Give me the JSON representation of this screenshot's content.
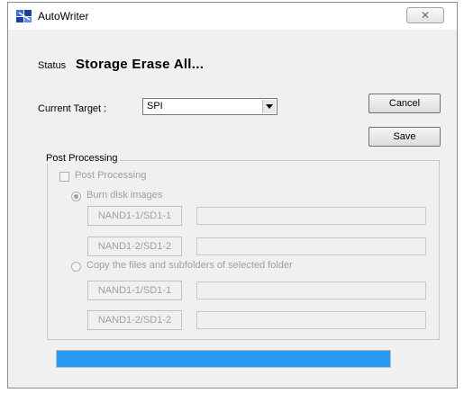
{
  "window": {
    "title": "AutoWriter",
    "close_glyph": "✕",
    "accent_color": "#2b9af3"
  },
  "status": {
    "label": "Status",
    "value": "Storage Erase All..."
  },
  "target": {
    "label": "Current Target :",
    "selected": "SPI"
  },
  "buttons": {
    "cancel": "Cancel",
    "save": "Save"
  },
  "post_processing": {
    "legend": "Post Processing",
    "checkbox_label": "Post Processing",
    "checkbox_checked": false,
    "burn": {
      "label": "Burn disk images",
      "selected": true,
      "rows": [
        {
          "button": "NAND1-1/SD1-1",
          "value": ""
        },
        {
          "button": "NAND1-2/SD1-2",
          "value": ""
        }
      ]
    },
    "copy": {
      "label": "Copy the files and subfolders of selected folder",
      "selected": false,
      "rows": [
        {
          "button": "NAND1-1/SD1-1",
          "value": ""
        },
        {
          "button": "NAND1-2/SD1-2",
          "value": ""
        }
      ]
    }
  },
  "progress": {
    "value_percent": 100
  }
}
